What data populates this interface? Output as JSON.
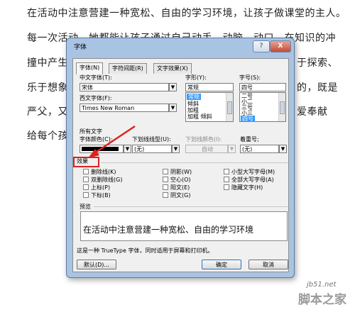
{
  "document": {
    "lines": [
      "在活动中注意营建一种宽松、自由的学习环境，让孩子做课堂的主人。",
      "每一次活动，她都能让孩子通过自己动手、动脑、动口，在知识的冲",
      "撞中产生",
      "乐于想象",
      "严父，又",
      "给每个孩"
    ],
    "right_fragments": [
      "于探索、",
      "的，既是",
      "爱奉献"
    ]
  },
  "dialog": {
    "title": "字体",
    "help_label": "?",
    "close_label": "X",
    "tabs": [
      "字体(N)",
      "字符间距(R)",
      "文字效果(X)"
    ],
    "chinese_font_label": "中文字体(T):",
    "chinese_font_value": "宋体",
    "western_font_label": "西文字体(F):",
    "western_font_value": "Times New Roman",
    "style_label": "字形(Y):",
    "style_value": "常规",
    "style_options": [
      "常规",
      "倾斜",
      "加粗",
      "加粗 倾斜"
    ],
    "size_label": "字号(S):",
    "size_value": "四号",
    "size_options": [
      "二号",
      "小二",
      "三号",
      "小三",
      "四号"
    ],
    "all_text_label": "所有文字",
    "font_color_label": "字体颜色(C):",
    "underline_label": "下划线线型(U):",
    "underline_value": "(无)",
    "underline_color_label": "下划线颜色(I):",
    "underline_color_value": "自动",
    "emphasis_label": "着重号;",
    "emphasis_value": "(无)",
    "effects_label": "效果",
    "effects": [
      [
        "删除线(K)",
        "阴影(W)",
        "小型大写字母(M)"
      ],
      [
        "双删除线(G)",
        "空心(O)",
        "全部大写字母(A)"
      ],
      [
        "上标(P)",
        "阳文(E)",
        "隐藏文字(H)"
      ],
      [
        "下标(B)",
        "阴文(G)",
        ""
      ]
    ],
    "preview_label": "预览",
    "preview_text": "在活动中注意营建一种宽松、自由的学习环境",
    "info_text": "这是一种 TrueType 字体，同时适用于屏幕和打印机。",
    "default_button": "默认(D)...",
    "ok_button": "确定",
    "cancel_button": "取消"
  },
  "watermark": {
    "line1": "jb51.net",
    "line2": "脚本之家"
  },
  "colors": {
    "dialog_frame": "#a9c3e3",
    "selection": "#3399ff",
    "callout": "#e02020"
  }
}
